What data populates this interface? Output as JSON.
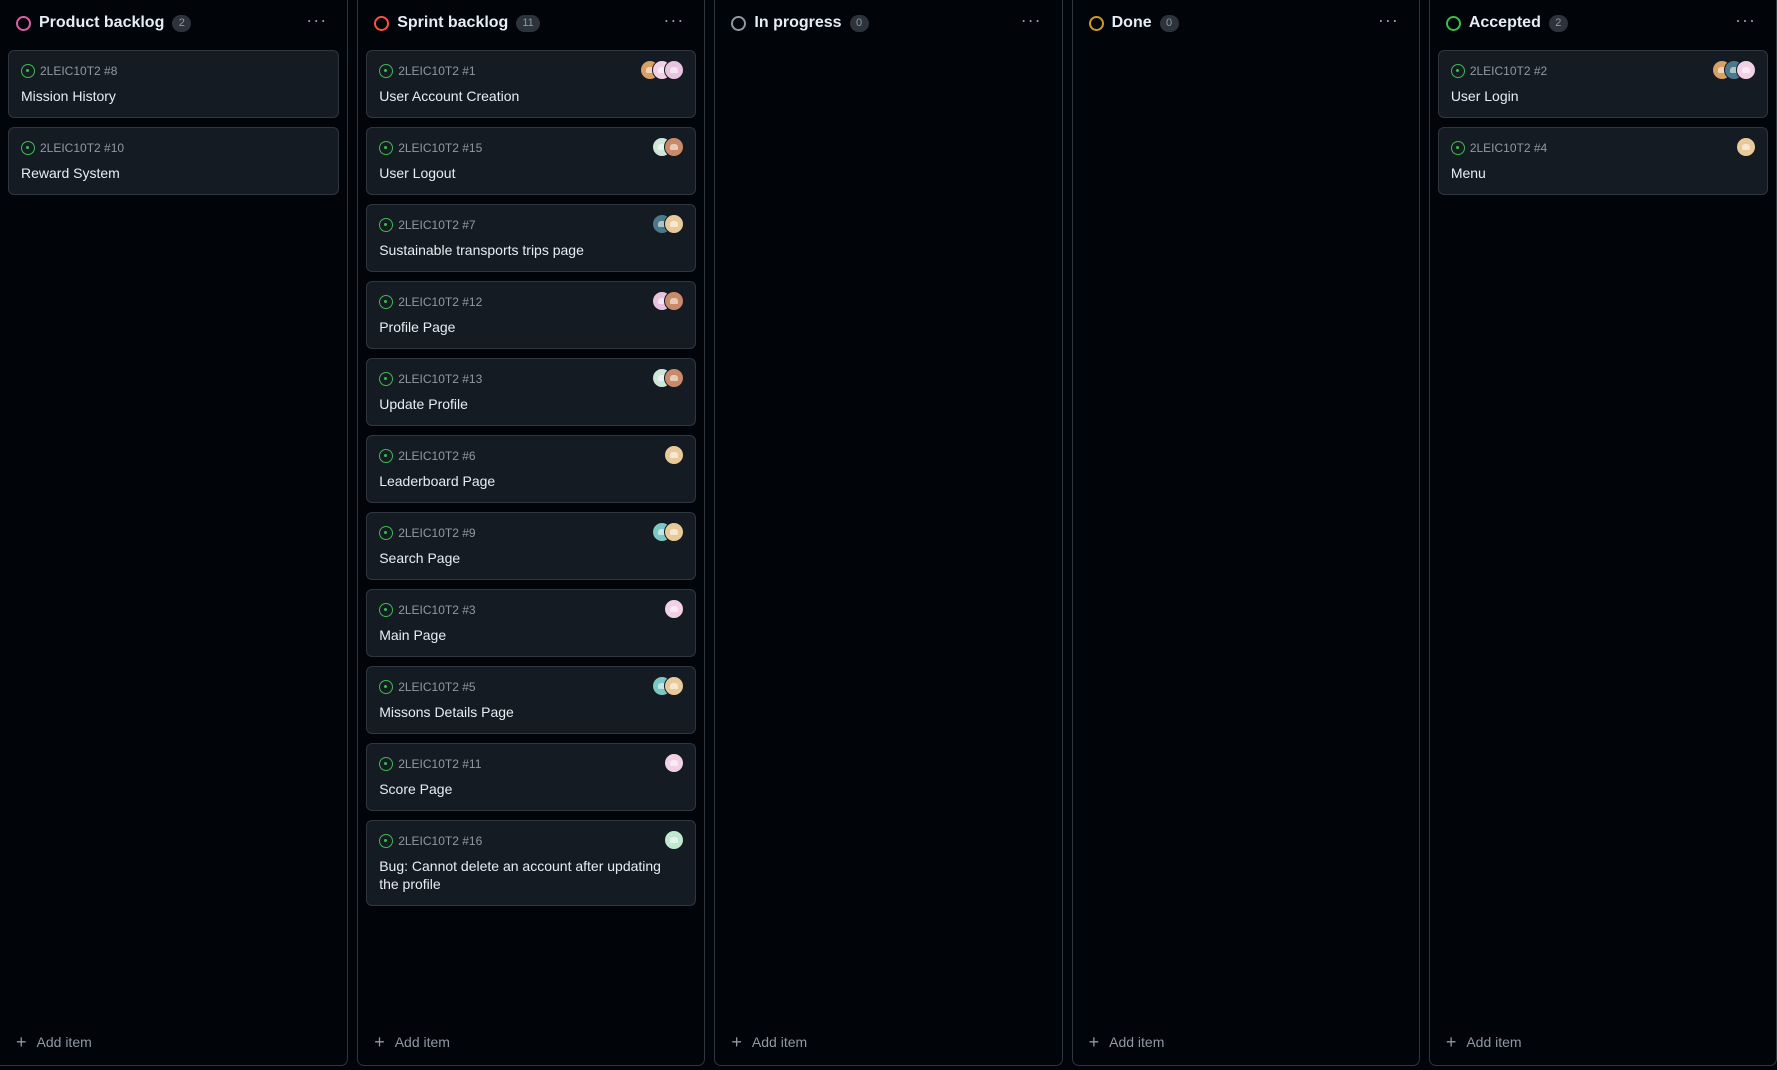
{
  "columns": [
    {
      "title": "Product backlog",
      "count": "2",
      "ring_color": "#db61a2",
      "add_label": "Add item",
      "cards": [
        {
          "ref": "2LEIC10T2 #8",
          "title": "Mission History",
          "avatars": []
        },
        {
          "ref": "2LEIC10T2 #10",
          "title": "Reward System",
          "avatars": []
        }
      ]
    },
    {
      "title": "Sprint backlog",
      "count": "11",
      "ring_color": "#f85149",
      "add_label": "Add item",
      "cards": [
        {
          "ref": "2LEIC10T2 #1",
          "title": "User Account Creation",
          "avatars": [
            "#d9a066",
            "#f2d0e6",
            "#e8c3e0"
          ]
        },
        {
          "ref": "2LEIC10T2 #15",
          "title": "User Logout",
          "avatars": [
            "#cfe6d8",
            "#c98a6a"
          ]
        },
        {
          "ref": "2LEIC10T2 #7",
          "title": "Sustainable transports trips page",
          "avatars": [
            "#4a7a8a",
            "#e8c99a"
          ]
        },
        {
          "ref": "2LEIC10T2 #12",
          "title": "Profile Page",
          "avatars": [
            "#e8c3e0",
            "#c98a6a"
          ]
        },
        {
          "ref": "2LEIC10T2 #13",
          "title": "Update Profile",
          "avatars": [
            "#cfe6d8",
            "#c98a6a"
          ]
        },
        {
          "ref": "2LEIC10T2 #6",
          "title": "Leaderboard Page",
          "avatars": [
            "#e8c99a"
          ]
        },
        {
          "ref": "2LEIC10T2 #9",
          "title": "Search Page",
          "avatars": [
            "#7ac7c4",
            "#e8c99a"
          ]
        },
        {
          "ref": "2LEIC10T2 #3",
          "title": "Main Page",
          "avatars": [
            "#f2d0e6"
          ]
        },
        {
          "ref": "2LEIC10T2 #5",
          "title": "Missons Details Page",
          "avatars": [
            "#7ac7c4",
            "#e8c99a"
          ]
        },
        {
          "ref": "2LEIC10T2 #11",
          "title": "Score Page",
          "avatars": [
            "#f2d0e6"
          ]
        },
        {
          "ref": "2LEIC10T2 #16",
          "title": "Bug: Cannot delete an account after updating the profile",
          "avatars": [
            "#bfe8cf"
          ]
        }
      ]
    },
    {
      "title": "In progress",
      "count": "0",
      "ring_color": "#9198a1",
      "add_label": "Add item",
      "cards": []
    },
    {
      "title": "Done",
      "count": "0",
      "ring_color": "#d29922",
      "add_label": "Add item",
      "cards": []
    },
    {
      "title": "Accepted",
      "count": "2",
      "ring_color": "#3fb950",
      "add_label": "Add item",
      "cards": [
        {
          "ref": "2LEIC10T2 #2",
          "title": "User Login",
          "avatars": [
            "#d9a066",
            "#4a7a8a",
            "#f2d0e6"
          ]
        },
        {
          "ref": "2LEIC10T2 #4",
          "title": "Menu",
          "avatars": [
            "#e8c99a"
          ]
        }
      ]
    }
  ],
  "menu_glyph": "···",
  "plus_glyph": "+"
}
